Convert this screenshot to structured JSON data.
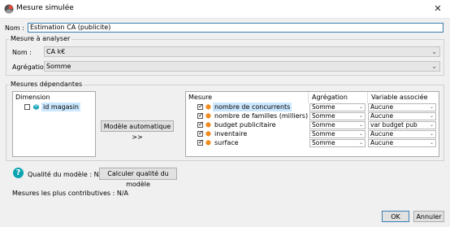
{
  "window": {
    "title": "Mesure simulée",
    "close_glyph": "✕"
  },
  "nom": {
    "label": "Nom :",
    "value": "Estimation CA (publicite)"
  },
  "mesure_a_analyser": {
    "legend": "Mesure à analyser",
    "nom_label": "Nom :",
    "nom_value": "CA k€",
    "agregation_label": "Agrégation",
    "agregation_value": "Somme"
  },
  "mesures_dependantes": {
    "legend": "Mesures dépendantes",
    "dimension_header": "Dimension",
    "dimension_item": "id magasin",
    "auto_button": "Modèle automatique >>",
    "columns": {
      "mesure": "Mesure",
      "agregation": "Agrégation",
      "variable": "Variable associée"
    },
    "rows": [
      {
        "mesure": "nombre de concurrents",
        "agregation": "Somme",
        "variable": "Aucune",
        "checked": true
      },
      {
        "mesure": "nombre de familles (milliers)",
        "agregation": "Somme",
        "variable": "Aucune",
        "checked": true
      },
      {
        "mesure": "budget publicitaire",
        "agregation": "Somme",
        "variable": "var budget pub",
        "checked": true
      },
      {
        "mesure": "inventaire",
        "agregation": "Somme",
        "variable": "Aucune",
        "checked": true
      },
      {
        "mesure": "surface",
        "agregation": "Somme",
        "variable": "Aucune",
        "checked": true
      }
    ]
  },
  "qualite": {
    "help_glyph": "?",
    "label": "Qualité du modèle : N/A",
    "button": "Calculer qualité du modèle"
  },
  "contributives": {
    "label": "Mesures les plus contributives : N/A"
  },
  "footer": {
    "ok": "OK",
    "annuler": "Annuler"
  },
  "colors": {
    "accent": "#3c7fb1",
    "cube": "#f08a1c",
    "help": "#0aa4b0",
    "selection": "#cce8ff"
  }
}
